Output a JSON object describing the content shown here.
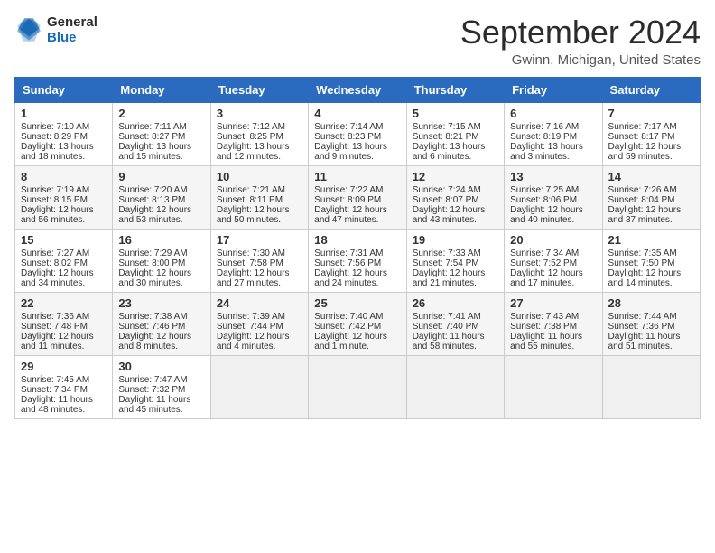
{
  "logo": {
    "line1": "General",
    "line2": "Blue"
  },
  "title": "September 2024",
  "subtitle": "Gwinn, Michigan, United States",
  "headers": [
    "Sunday",
    "Monday",
    "Tuesday",
    "Wednesday",
    "Thursday",
    "Friday",
    "Saturday"
  ],
  "weeks": [
    [
      {
        "day": "1",
        "sunrise": "Sunrise: 7:10 AM",
        "sunset": "Sunset: 8:29 PM",
        "daylight": "Daylight: 13 hours and 18 minutes."
      },
      {
        "day": "2",
        "sunrise": "Sunrise: 7:11 AM",
        "sunset": "Sunset: 8:27 PM",
        "daylight": "Daylight: 13 hours and 15 minutes."
      },
      {
        "day": "3",
        "sunrise": "Sunrise: 7:12 AM",
        "sunset": "Sunset: 8:25 PM",
        "daylight": "Daylight: 13 hours and 12 minutes."
      },
      {
        "day": "4",
        "sunrise": "Sunrise: 7:14 AM",
        "sunset": "Sunset: 8:23 PM",
        "daylight": "Daylight: 13 hours and 9 minutes."
      },
      {
        "day": "5",
        "sunrise": "Sunrise: 7:15 AM",
        "sunset": "Sunset: 8:21 PM",
        "daylight": "Daylight: 13 hours and 6 minutes."
      },
      {
        "day": "6",
        "sunrise": "Sunrise: 7:16 AM",
        "sunset": "Sunset: 8:19 PM",
        "daylight": "Daylight: 13 hours and 3 minutes."
      },
      {
        "day": "7",
        "sunrise": "Sunrise: 7:17 AM",
        "sunset": "Sunset: 8:17 PM",
        "daylight": "Daylight: 12 hours and 59 minutes."
      }
    ],
    [
      {
        "day": "8",
        "sunrise": "Sunrise: 7:19 AM",
        "sunset": "Sunset: 8:15 PM",
        "daylight": "Daylight: 12 hours and 56 minutes."
      },
      {
        "day": "9",
        "sunrise": "Sunrise: 7:20 AM",
        "sunset": "Sunset: 8:13 PM",
        "daylight": "Daylight: 12 hours and 53 minutes."
      },
      {
        "day": "10",
        "sunrise": "Sunrise: 7:21 AM",
        "sunset": "Sunset: 8:11 PM",
        "daylight": "Daylight: 12 hours and 50 minutes."
      },
      {
        "day": "11",
        "sunrise": "Sunrise: 7:22 AM",
        "sunset": "Sunset: 8:09 PM",
        "daylight": "Daylight: 12 hours and 47 minutes."
      },
      {
        "day": "12",
        "sunrise": "Sunrise: 7:24 AM",
        "sunset": "Sunset: 8:07 PM",
        "daylight": "Daylight: 12 hours and 43 minutes."
      },
      {
        "day": "13",
        "sunrise": "Sunrise: 7:25 AM",
        "sunset": "Sunset: 8:06 PM",
        "daylight": "Daylight: 12 hours and 40 minutes."
      },
      {
        "day": "14",
        "sunrise": "Sunrise: 7:26 AM",
        "sunset": "Sunset: 8:04 PM",
        "daylight": "Daylight: 12 hours and 37 minutes."
      }
    ],
    [
      {
        "day": "15",
        "sunrise": "Sunrise: 7:27 AM",
        "sunset": "Sunset: 8:02 PM",
        "daylight": "Daylight: 12 hours and 34 minutes."
      },
      {
        "day": "16",
        "sunrise": "Sunrise: 7:29 AM",
        "sunset": "Sunset: 8:00 PM",
        "daylight": "Daylight: 12 hours and 30 minutes."
      },
      {
        "day": "17",
        "sunrise": "Sunrise: 7:30 AM",
        "sunset": "Sunset: 7:58 PM",
        "daylight": "Daylight: 12 hours and 27 minutes."
      },
      {
        "day": "18",
        "sunrise": "Sunrise: 7:31 AM",
        "sunset": "Sunset: 7:56 PM",
        "daylight": "Daylight: 12 hours and 24 minutes."
      },
      {
        "day": "19",
        "sunrise": "Sunrise: 7:33 AM",
        "sunset": "Sunset: 7:54 PM",
        "daylight": "Daylight: 12 hours and 21 minutes."
      },
      {
        "day": "20",
        "sunrise": "Sunrise: 7:34 AM",
        "sunset": "Sunset: 7:52 PM",
        "daylight": "Daylight: 12 hours and 17 minutes."
      },
      {
        "day": "21",
        "sunrise": "Sunrise: 7:35 AM",
        "sunset": "Sunset: 7:50 PM",
        "daylight": "Daylight: 12 hours and 14 minutes."
      }
    ],
    [
      {
        "day": "22",
        "sunrise": "Sunrise: 7:36 AM",
        "sunset": "Sunset: 7:48 PM",
        "daylight": "Daylight: 12 hours and 11 minutes."
      },
      {
        "day": "23",
        "sunrise": "Sunrise: 7:38 AM",
        "sunset": "Sunset: 7:46 PM",
        "daylight": "Daylight: 12 hours and 8 minutes."
      },
      {
        "day": "24",
        "sunrise": "Sunrise: 7:39 AM",
        "sunset": "Sunset: 7:44 PM",
        "daylight": "Daylight: 12 hours and 4 minutes."
      },
      {
        "day": "25",
        "sunrise": "Sunrise: 7:40 AM",
        "sunset": "Sunset: 7:42 PM",
        "daylight": "Daylight: 12 hours and 1 minute."
      },
      {
        "day": "26",
        "sunrise": "Sunrise: 7:41 AM",
        "sunset": "Sunset: 7:40 PM",
        "daylight": "Daylight: 11 hours and 58 minutes."
      },
      {
        "day": "27",
        "sunrise": "Sunrise: 7:43 AM",
        "sunset": "Sunset: 7:38 PM",
        "daylight": "Daylight: 11 hours and 55 minutes."
      },
      {
        "day": "28",
        "sunrise": "Sunrise: 7:44 AM",
        "sunset": "Sunset: 7:36 PM",
        "daylight": "Daylight: 11 hours and 51 minutes."
      }
    ],
    [
      {
        "day": "29",
        "sunrise": "Sunrise: 7:45 AM",
        "sunset": "Sunset: 7:34 PM",
        "daylight": "Daylight: 11 hours and 48 minutes."
      },
      {
        "day": "30",
        "sunrise": "Sunrise: 7:47 AM",
        "sunset": "Sunset: 7:32 PM",
        "daylight": "Daylight: 11 hours and 45 minutes."
      },
      null,
      null,
      null,
      null,
      null
    ]
  ]
}
